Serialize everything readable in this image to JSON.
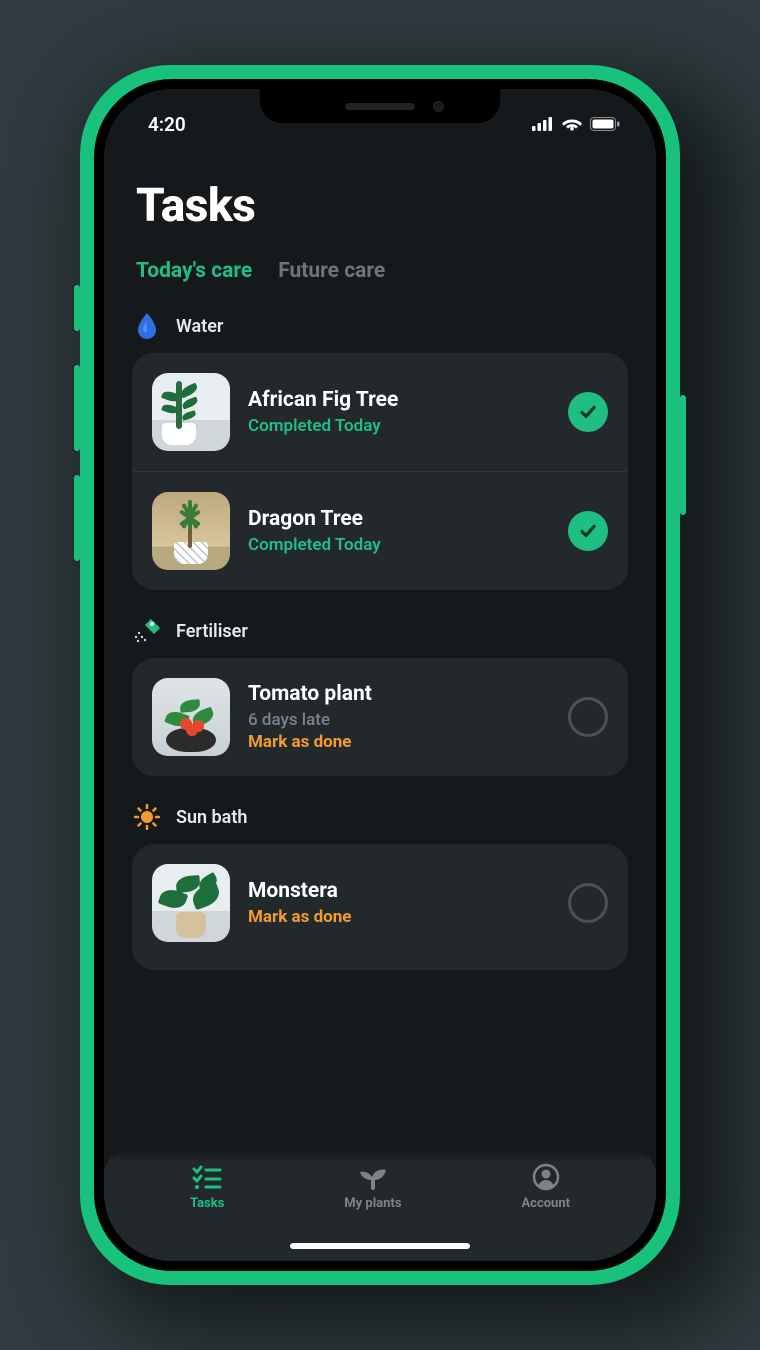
{
  "status": {
    "time": "4:20"
  },
  "page": {
    "title": "Tasks"
  },
  "tabs": [
    {
      "label": "Today's care",
      "active": true
    },
    {
      "label": "Future care",
      "active": false
    }
  ],
  "sections": [
    {
      "icon": "water-drop-icon",
      "label": "Water",
      "items": [
        {
          "name": "African Fig Tree",
          "status": "Completed Today",
          "completed": true
        },
        {
          "name": "Dragon Tree",
          "status": "Completed Today",
          "completed": true
        }
      ]
    },
    {
      "icon": "fertiliser-icon",
      "label": "Fertiliser",
      "items": [
        {
          "name": "Tomato plant",
          "late": "6 days late",
          "action": "Mark as done",
          "completed": false
        }
      ]
    },
    {
      "icon": "sun-icon",
      "label": "Sun bath",
      "items": [
        {
          "name": "Monstera",
          "action": "Mark as done",
          "completed": false
        }
      ]
    }
  ],
  "nav": [
    {
      "label": "Tasks",
      "icon": "tasks-icon",
      "active": true
    },
    {
      "label": "My plants",
      "icon": "sprout-icon",
      "active": false
    },
    {
      "label": "Account",
      "icon": "account-icon",
      "active": false
    }
  ],
  "colors": {
    "accent": "#1fbf84",
    "warning": "#f39c2d",
    "device_frame": "#18c27b"
  }
}
